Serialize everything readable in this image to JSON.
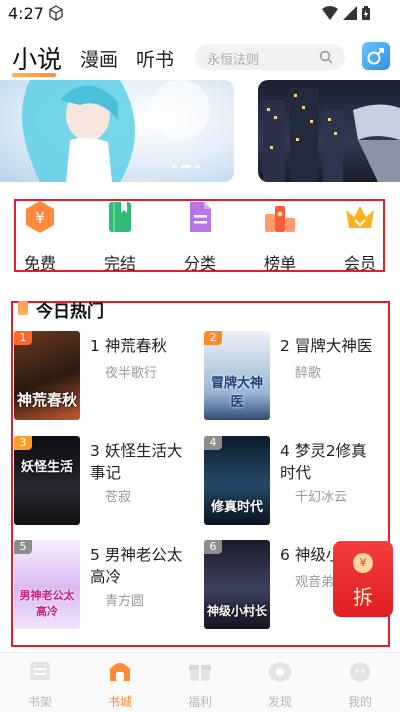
{
  "status_bar": {
    "time": "4:27"
  },
  "top_tabs": {
    "novel": "小说",
    "comic": "漫画",
    "audiobook": "听书"
  },
  "search": {
    "placeholder": "永恒法则"
  },
  "categories": [
    {
      "label": "免费",
      "icon": "coin-icon",
      "color": "#ff8a3c"
    },
    {
      "label": "完结",
      "icon": "book-icon",
      "color": "#2fba78"
    },
    {
      "label": "分类",
      "icon": "document-icon",
      "color": "#b775e6"
    },
    {
      "label": "榜单",
      "icon": "ranking-icon",
      "color": "#ff6a4a"
    },
    {
      "label": "会员",
      "icon": "crown-icon",
      "color": "#ffb21e"
    }
  ],
  "hot": {
    "title": "今日热门",
    "books": [
      {
        "rank": "1",
        "name": "神荒春秋",
        "author": "夜半歌行",
        "cover_text": "神荒春秋"
      },
      {
        "rank": "2",
        "name": "冒牌大神医",
        "author": "醉歌",
        "cover_text": "冒牌大神医"
      },
      {
        "rank": "3",
        "name": "妖怪生活大事记",
        "author": "苍寂",
        "cover_text": "妖怪生活"
      },
      {
        "rank": "4",
        "name": "梦灵2修真时代",
        "author": "千幻冰云",
        "cover_text": "修真时代"
      },
      {
        "rank": "5",
        "name": "男神老公太高冷",
        "author": "青方圆",
        "cover_text": "男神老公太高冷"
      },
      {
        "rank": "6",
        "name": "神级小",
        "author": "观音弟",
        "cover_text": "神级小村长"
      }
    ]
  },
  "red_envelope": {
    "label": "拆",
    "coin": "¥"
  },
  "bottom_nav": [
    {
      "label": "书架",
      "active": false
    },
    {
      "label": "书城",
      "active": true
    },
    {
      "label": "福利",
      "active": false
    },
    {
      "label": "发现",
      "active": false
    },
    {
      "label": "我的",
      "active": false
    }
  ],
  "colors": {
    "accent": "#ff8a3c",
    "highlight_box": "#e0202c"
  }
}
